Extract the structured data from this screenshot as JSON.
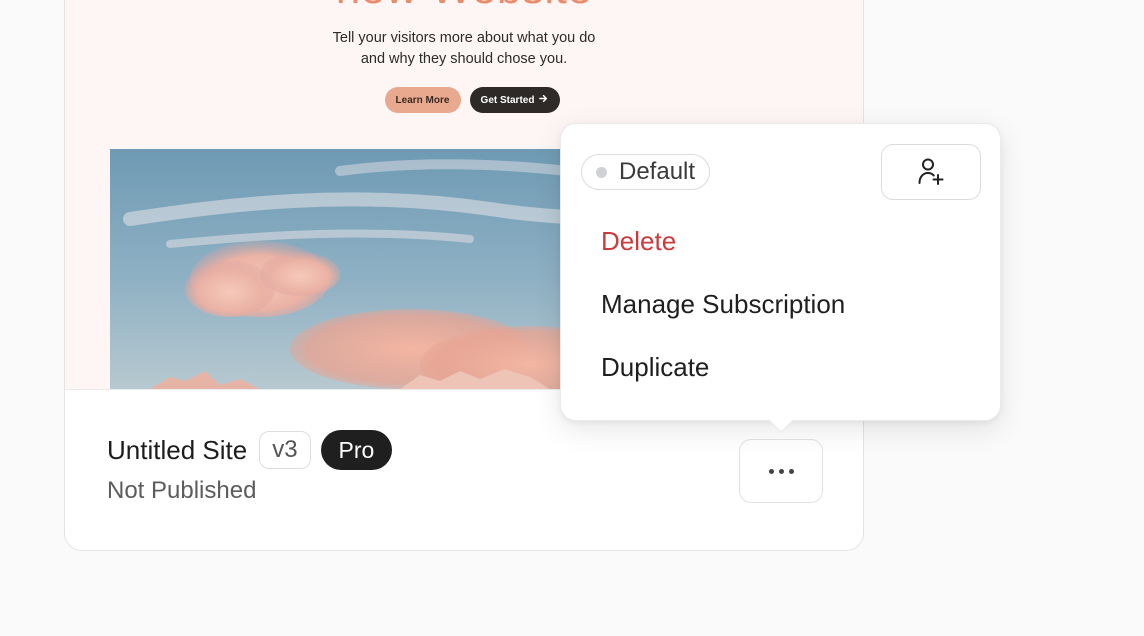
{
  "preview": {
    "hero_title": "new Website",
    "hero_subtitle_line1": "Tell your visitors more about what you do",
    "hero_subtitle_line2": "and why they should chose you.",
    "learn_more_label": "Learn More",
    "get_started_label": "Get Started",
    "arrow_icon": "arrow-right-icon"
  },
  "site": {
    "name": "Untitled Site",
    "version": "v3",
    "plan": "Pro",
    "status": "Not Published",
    "more_icon": "ellipsis-icon"
  },
  "menu": {
    "workspace_label": "Default",
    "invite_icon": "add-user-icon",
    "items": [
      {
        "label": "Delete",
        "variant": "danger"
      },
      {
        "label": "Manage Subscription",
        "variant": "default"
      },
      {
        "label": "Duplicate",
        "variant": "default"
      }
    ]
  },
  "colors": {
    "hero_accent": "#e88e6c",
    "learn_more_bg": "#e8a98e",
    "get_started_bg": "#2d2a28",
    "pro_badge_bg": "#1f1f1f",
    "danger": "#cc3b3b"
  }
}
